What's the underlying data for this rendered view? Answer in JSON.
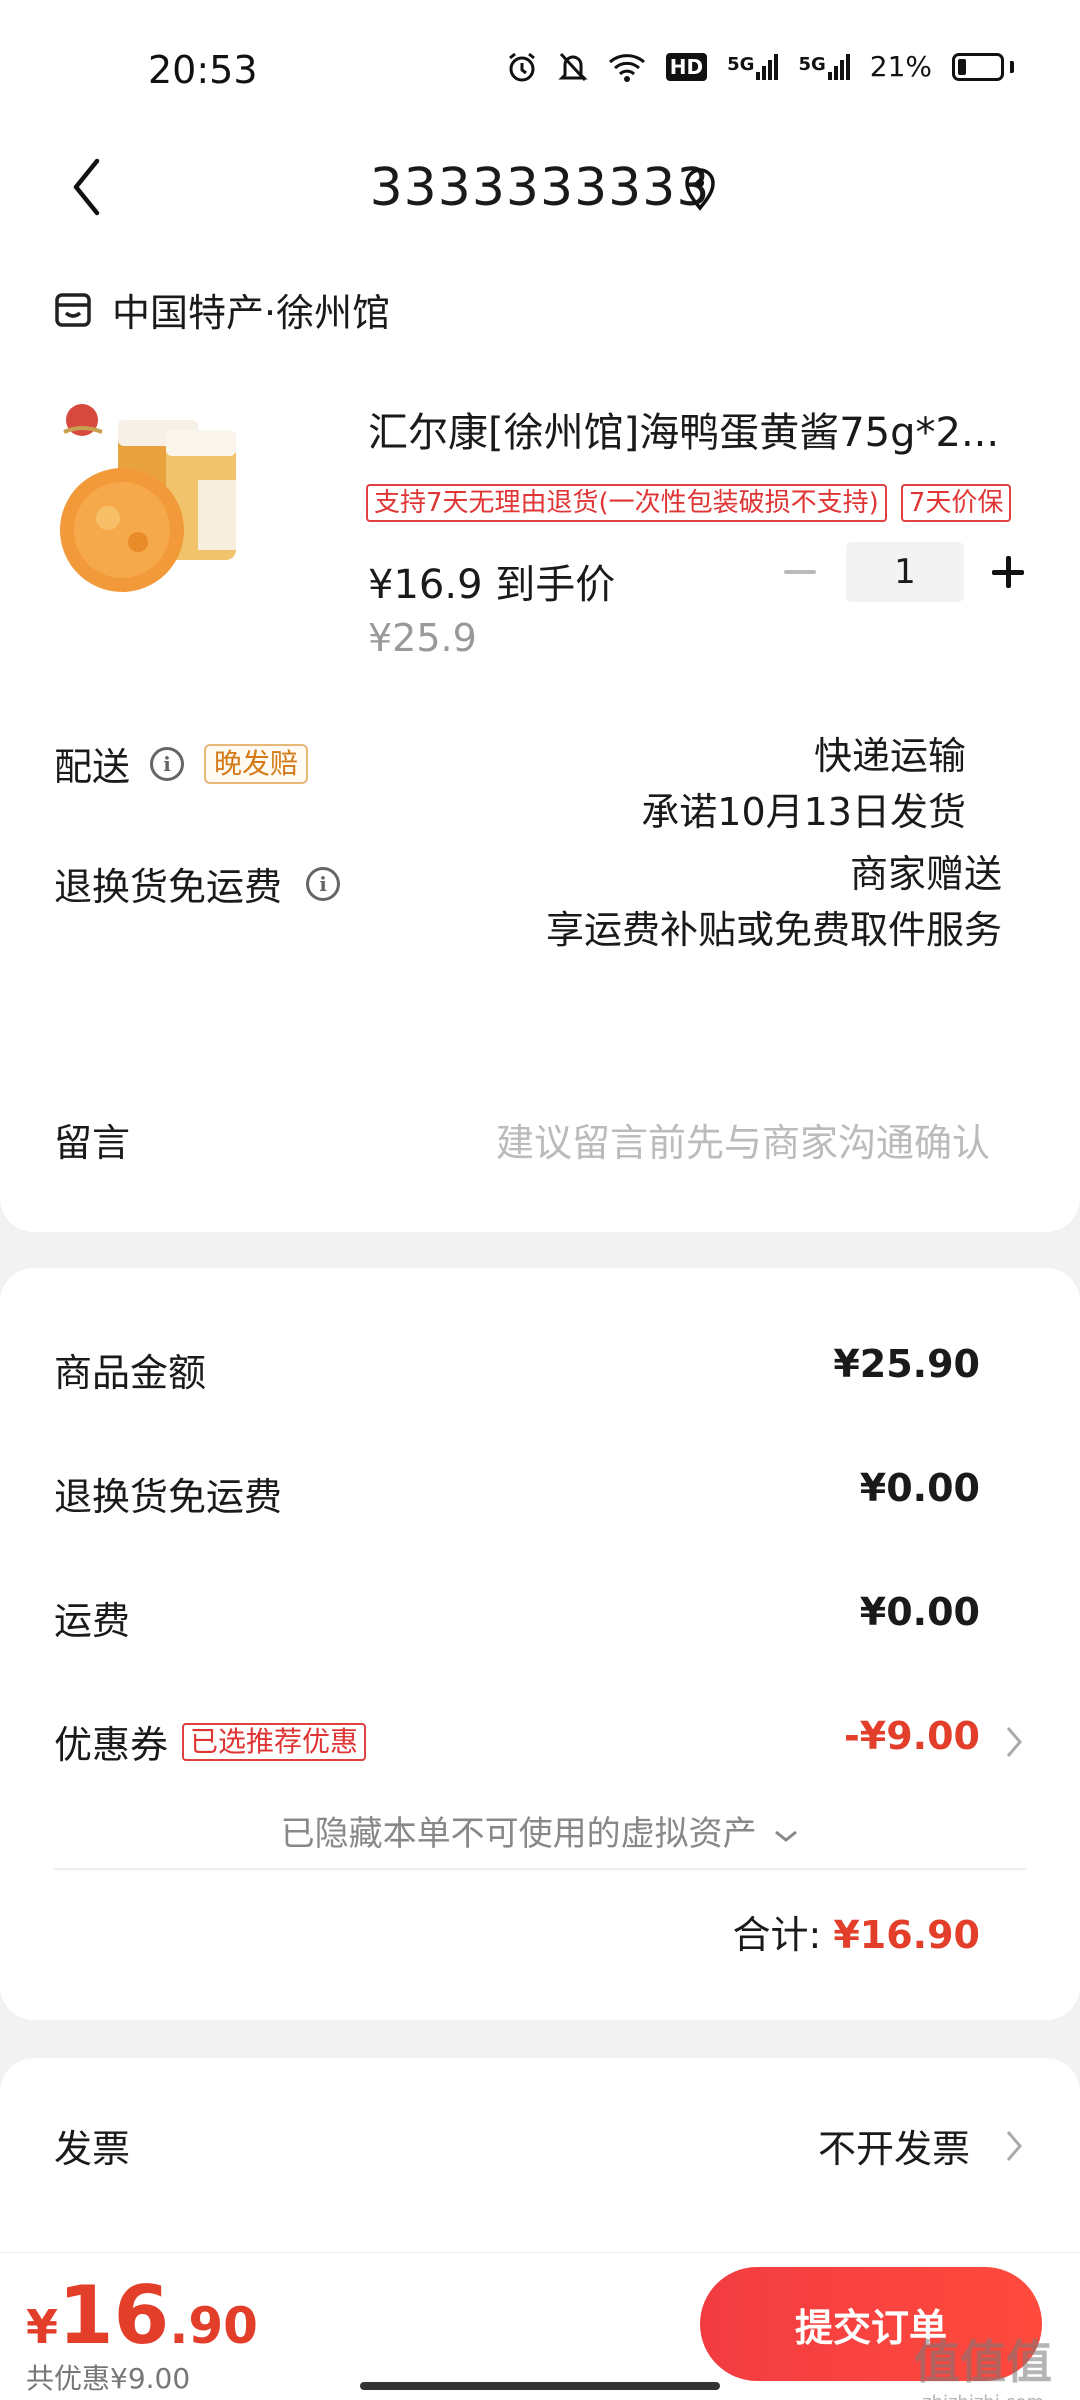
{
  "status_bar": {
    "time": "20:53",
    "network_label_1": "HD",
    "network_label_2": "5G",
    "network_label_3": "5G",
    "battery": "21%"
  },
  "header": {
    "title": "3333333333"
  },
  "shop": {
    "name": "中国特产·徐州馆"
  },
  "product": {
    "title": "汇尔康[徐州馆]海鸭蛋黄酱75g*2...",
    "tags": [
      "支持7天无理由退货(一次性包装破损不支持)",
      "7天价保"
    ],
    "price_now": "¥16.9 到手价",
    "price_old": "¥25.9",
    "quantity": "1"
  },
  "delivery": {
    "label": "配送",
    "tag": "晚发赔",
    "method": "快递运输",
    "promise": "承诺10月13日发货"
  },
  "return_shipping": {
    "label": "退换货免运费",
    "line1": "商家赠送",
    "line2": "享运费补贴或免费取件服务"
  },
  "message": {
    "label": "留言",
    "placeholder": "建议留言前先与商家沟通确认"
  },
  "summary": {
    "goods_label": "商品金额",
    "goods_value": "¥25.90",
    "return_label": "退换货免运费",
    "return_value": "¥0.00",
    "shipping_label": "运费",
    "shipping_value": "¥0.00",
    "coupon_label": "优惠券",
    "coupon_tag": "已选推荐优惠",
    "coupon_value": "-¥9.00",
    "hidden_note": "已隐藏本单不可使用的虚拟资产",
    "total_label": "合计:",
    "total_value": "¥16.90"
  },
  "invoice": {
    "label": "发票",
    "value": "不开发票"
  },
  "bottom_bar": {
    "price_symbol": "¥",
    "price_integer": "16",
    "price_decimal": ".90",
    "discount_note": "共优惠¥9.00",
    "submit_label": "提交订单"
  },
  "watermark": {
    "text": "值值值",
    "sub": "zhizhizhi.com"
  },
  "colors": {
    "accent_red": "#e23e2a",
    "button_red": "#f23c42",
    "tag_orange": "#d47b18",
    "background": "#f2f2f2"
  }
}
